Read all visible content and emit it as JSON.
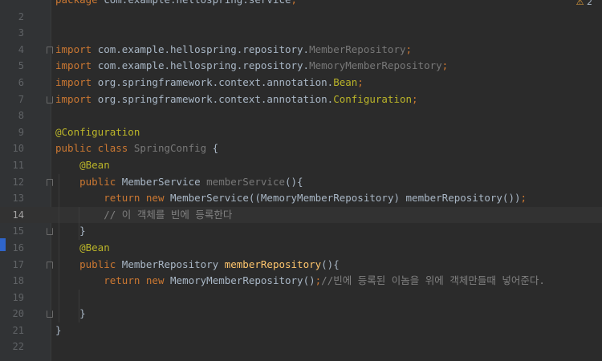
{
  "editor": {
    "inspection": {
      "icon": "warning-icon",
      "count": "2"
    },
    "current_line": "14",
    "lines": [
      {
        "num": "3",
        "tokens": []
      },
      {
        "num": "2",
        "tokens": []
      },
      {
        "num": "3",
        "tokens": []
      },
      {
        "num": "4",
        "tokens": [
          {
            "t": "import ",
            "c": "kw"
          },
          {
            "t": "com.example.hellospring.repository.",
            "c": ""
          },
          {
            "t": "MemberRepository",
            "c": "gr"
          },
          {
            "t": ";",
            "c": "kw"
          }
        ]
      },
      {
        "num": "5",
        "tokens": [
          {
            "t": "import ",
            "c": "kw"
          },
          {
            "t": "com.example.hellospring.repository.",
            "c": ""
          },
          {
            "t": "MemoryMemberRepository",
            "c": "gr"
          },
          {
            "t": ";",
            "c": "kw"
          }
        ]
      },
      {
        "num": "6",
        "tokens": [
          {
            "t": "import ",
            "c": "kw"
          },
          {
            "t": "org.springframework.context.annotation.",
            "c": ""
          },
          {
            "t": "Bean",
            "c": "ann"
          },
          {
            "t": ";",
            "c": "kw"
          }
        ]
      },
      {
        "num": "7",
        "tokens": [
          {
            "t": "import ",
            "c": "kw"
          },
          {
            "t": "org.springframework.context.annotation.",
            "c": ""
          },
          {
            "t": "Configuration",
            "c": "ann"
          },
          {
            "t": ";",
            "c": "kw"
          }
        ]
      },
      {
        "num": "8",
        "tokens": []
      },
      {
        "num": "9",
        "tokens": [
          {
            "t": "@Configuration",
            "c": "ann"
          }
        ]
      },
      {
        "num": "10",
        "tokens": [
          {
            "t": "public class ",
            "c": "kw"
          },
          {
            "t": "SpringConfig",
            "c": "gr"
          },
          {
            "t": " {",
            "c": ""
          }
        ]
      },
      {
        "num": "11",
        "tokens": [
          {
            "t": "    ",
            "c": ""
          },
          {
            "t": "@Bean",
            "c": "ann"
          }
        ]
      },
      {
        "num": "12",
        "tokens": [
          {
            "t": "    ",
            "c": ""
          },
          {
            "t": "public ",
            "c": "kw"
          },
          {
            "t": "MemberService ",
            "c": ""
          },
          {
            "t": "memberService",
            "c": "gr"
          },
          {
            "t": "(){",
            "c": ""
          }
        ]
      },
      {
        "num": "13",
        "tokens": [
          {
            "t": "        ",
            "c": ""
          },
          {
            "t": "return new ",
            "c": "kw"
          },
          {
            "t": "MemberService((MemoryMemberRepository) memberRepository())",
            "c": ""
          },
          {
            "t": ";",
            "c": "kw"
          }
        ]
      },
      {
        "num": "14",
        "tokens": [
          {
            "t": "        ",
            "c": ""
          },
          {
            "t": "// 이 객체를 빈에 등록한다",
            "c": "cm"
          }
        ]
      },
      {
        "num": "15",
        "tokens": [
          {
            "t": "    }",
            "c": ""
          }
        ]
      },
      {
        "num": "16",
        "tokens": [
          {
            "t": "    ",
            "c": ""
          },
          {
            "t": "@Bean",
            "c": "ann"
          }
        ]
      },
      {
        "num": "17",
        "tokens": [
          {
            "t": "    ",
            "c": ""
          },
          {
            "t": "public ",
            "c": "kw"
          },
          {
            "t": "MemberRepository ",
            "c": ""
          },
          {
            "t": "memberRepository",
            "c": "fn"
          },
          {
            "t": "(){",
            "c": ""
          }
        ]
      },
      {
        "num": "18",
        "tokens": [
          {
            "t": "        ",
            "c": ""
          },
          {
            "t": "return new ",
            "c": "kw"
          },
          {
            "t": "MemoryMemberRepository()",
            "c": ""
          },
          {
            "t": ";",
            "c": "kw"
          },
          {
            "t": "//빈에 등록된 이놈을 위에 객체만들때 넣어준다.",
            "c": "cm"
          }
        ]
      },
      {
        "num": "19",
        "tokens": []
      },
      {
        "num": "20",
        "tokens": [
          {
            "t": "    }",
            "c": ""
          }
        ]
      },
      {
        "num": "21",
        "tokens": [
          {
            "t": "}",
            "c": ""
          }
        ]
      },
      {
        "num": "22",
        "tokens": []
      }
    ],
    "partial_first_line": [
      {
        "t": "package ",
        "c": "kw"
      },
      {
        "t": "com.example.hellospring.service",
        "c": ""
      },
      {
        "t": ";",
        "c": "kw"
      }
    ],
    "folds": {
      "4": "up",
      "7": "down",
      "12": "up",
      "15": "down",
      "17": "up",
      "20": "down"
    }
  }
}
